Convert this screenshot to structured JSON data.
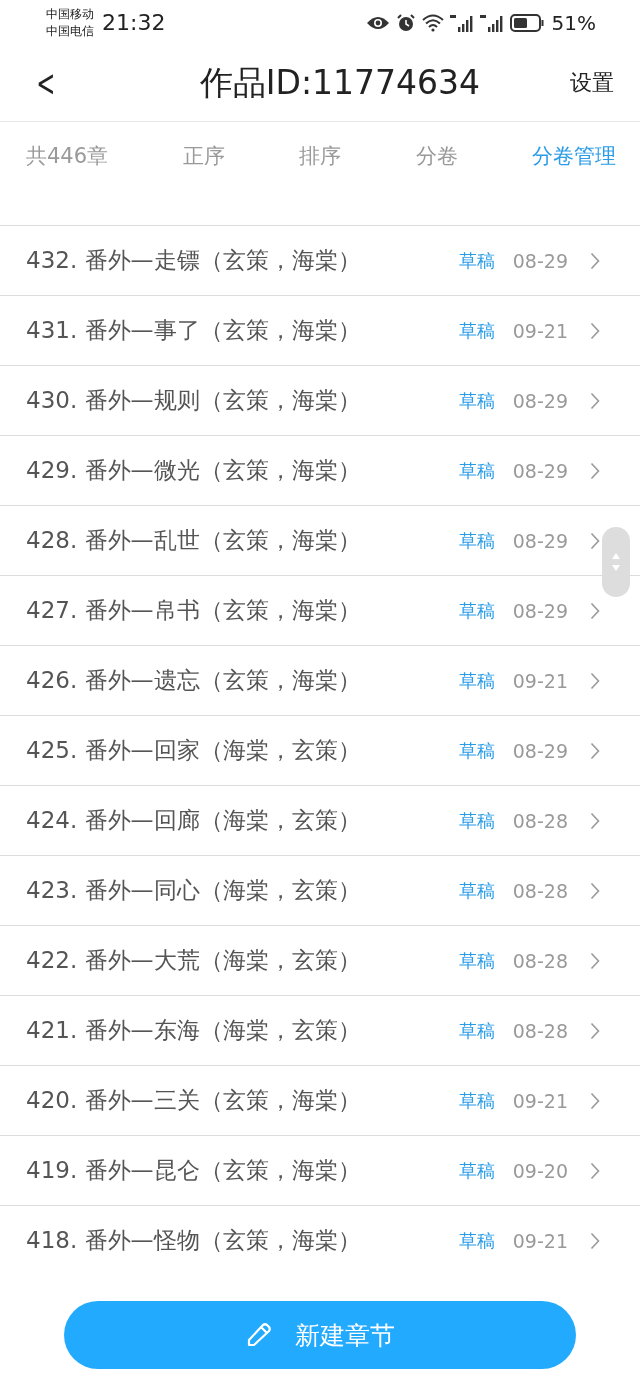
{
  "status_bar": {
    "carriers": [
      "中国移动",
      "中国电信"
    ],
    "time": "21:32",
    "battery": "51%"
  },
  "header": {
    "back": "<",
    "title": "作品ID:11774634",
    "action": "设置"
  },
  "toolbar": {
    "count": "共446章",
    "tabs": [
      {
        "label": "正序",
        "selected": false
      },
      {
        "label": "排序",
        "selected": false
      },
      {
        "label": "分卷",
        "selected": false
      },
      {
        "label": "分卷管理",
        "selected": true
      }
    ]
  },
  "chapters": [
    {
      "title": "432. 番外—走镖（玄策，海棠）",
      "status": "草稿",
      "date": "08-29"
    },
    {
      "title": "431. 番外—事了（玄策，海棠）",
      "status": "草稿",
      "date": "09-21"
    },
    {
      "title": "430. 番外—规则（玄策，海棠）",
      "status": "草稿",
      "date": "08-29"
    },
    {
      "title": "429. 番外—微光（玄策，海棠）",
      "status": "草稿",
      "date": "08-29"
    },
    {
      "title": "428. 番外—乱世（玄策，海棠）",
      "status": "草稿",
      "date": "08-29"
    },
    {
      "title": "427. 番外—帛书（玄策，海棠）",
      "status": "草稿",
      "date": "08-29"
    },
    {
      "title": "426. 番外—遗忘（玄策，海棠）",
      "status": "草稿",
      "date": "09-21"
    },
    {
      "title": "425. 番外—回家（海棠，玄策）",
      "status": "草稿",
      "date": "08-29"
    },
    {
      "title": "424. 番外—回廊（海棠，玄策）",
      "status": "草稿",
      "date": "08-28"
    },
    {
      "title": "423. 番外—同心（海棠，玄策）",
      "status": "草稿",
      "date": "08-28"
    },
    {
      "title": "422. 番外—大荒（海棠，玄策）",
      "status": "草稿",
      "date": "08-28"
    },
    {
      "title": "421. 番外—东海（海棠，玄策）",
      "status": "草稿",
      "date": "08-28"
    },
    {
      "title": "420. 番外—三关（玄策，海棠）",
      "status": "草稿",
      "date": "09-21"
    },
    {
      "title": "419. 番外—昆仑（玄策，海棠）",
      "status": "草稿",
      "date": "09-20"
    },
    {
      "title": "418. 番外—怪物（玄策，海棠）",
      "status": "草稿",
      "date": "09-21"
    }
  ],
  "new_button": "新建章节"
}
